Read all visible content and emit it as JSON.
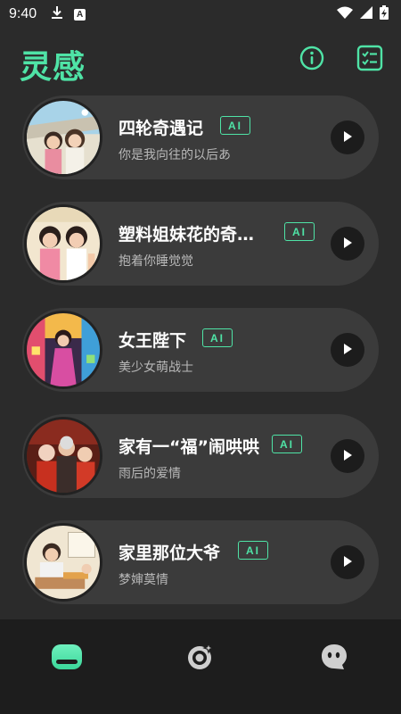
{
  "status_bar": {
    "time": "9:40",
    "left_icons": [
      "download-icon",
      "a-badge-icon"
    ],
    "a_badge_text": "A",
    "right_icons": [
      "wifi-icon",
      "signal-icon",
      "battery-charging-icon"
    ]
  },
  "header": {
    "title": "灵感",
    "info_icon": "info-icon",
    "list_icon": "checklist-icon"
  },
  "colors": {
    "accent": "#4fe3a6",
    "background": "#2b2b2b",
    "card": "#3b3b3b",
    "nav_background": "#1d1d1d"
  },
  "cards": [
    {
      "title": "四轮奇遇记",
      "subtitle": "你是我向往的以后あ",
      "badge": "AI"
    },
    {
      "title": "塑料姐妹花的奇…",
      "subtitle": "抱着你睡觉觉",
      "badge": "AI"
    },
    {
      "title": "女王陛下",
      "subtitle": "美少女萌战士",
      "badge": "AI"
    },
    {
      "title": "家有一“福”闹哄哄",
      "subtitle": "雨后的爱情",
      "badge": "AI"
    },
    {
      "title": "家里那位大爷",
      "subtitle": "梦婶莫情",
      "badge": "AI"
    }
  ],
  "bottom_nav": {
    "items": [
      {
        "icon": "home-icon",
        "active": true
      },
      {
        "icon": "discover-icon",
        "active": false
      },
      {
        "icon": "chat-icon",
        "active": false
      }
    ]
  }
}
